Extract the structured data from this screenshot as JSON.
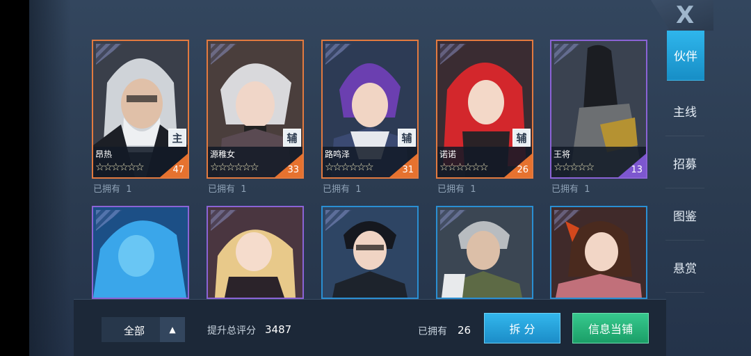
{
  "close_label": "X",
  "nav": {
    "items": [
      {
        "label": "伙伴",
        "active": true
      },
      {
        "label": "主线",
        "active": false
      },
      {
        "label": "招募",
        "active": false
      },
      {
        "label": "图鉴",
        "active": false
      },
      {
        "label": "悬赏",
        "active": false
      }
    ]
  },
  "cards_row1": [
    {
      "name": "昂热",
      "role": "主",
      "stars": "☆☆☆☆☆☆",
      "level": "47",
      "owned_label": "已拥有",
      "owned_count": "1"
    },
    {
      "name": "源稚女",
      "role": "辅",
      "stars": "☆☆☆☆☆☆",
      "level": "33",
      "owned_label": "已拥有",
      "owned_count": "1"
    },
    {
      "name": "路鸣泽",
      "role": "辅",
      "stars": "☆☆☆☆☆☆",
      "level": "31",
      "owned_label": "已拥有",
      "owned_count": "1"
    },
    {
      "name": "诺诺",
      "role": "辅",
      "stars": "☆☆☆☆☆☆",
      "level": "26",
      "owned_label": "已拥有",
      "owned_count": "1"
    },
    {
      "name": "王将",
      "role": "",
      "stars": "☆☆☆☆☆",
      "level": "13",
      "owned_label": "已拥有",
      "owned_count": "1"
    }
  ],
  "bottom": {
    "filter_label": "全部",
    "filter_arrow": "▲",
    "score_label": "提升总评分",
    "score_value": "3487",
    "owned_label": "已拥有",
    "owned_value": "26",
    "split_button": "拆 分",
    "pawn_button": "信息当铺"
  },
  "colors": {
    "orange_frame": "#e37a3f",
    "purple_frame": "#8b63d6",
    "blue_frame": "#2a8fd3",
    "nav_active": "#2fb6ec",
    "split_button": "#33b7ec",
    "pawn_button": "#37c98e"
  }
}
